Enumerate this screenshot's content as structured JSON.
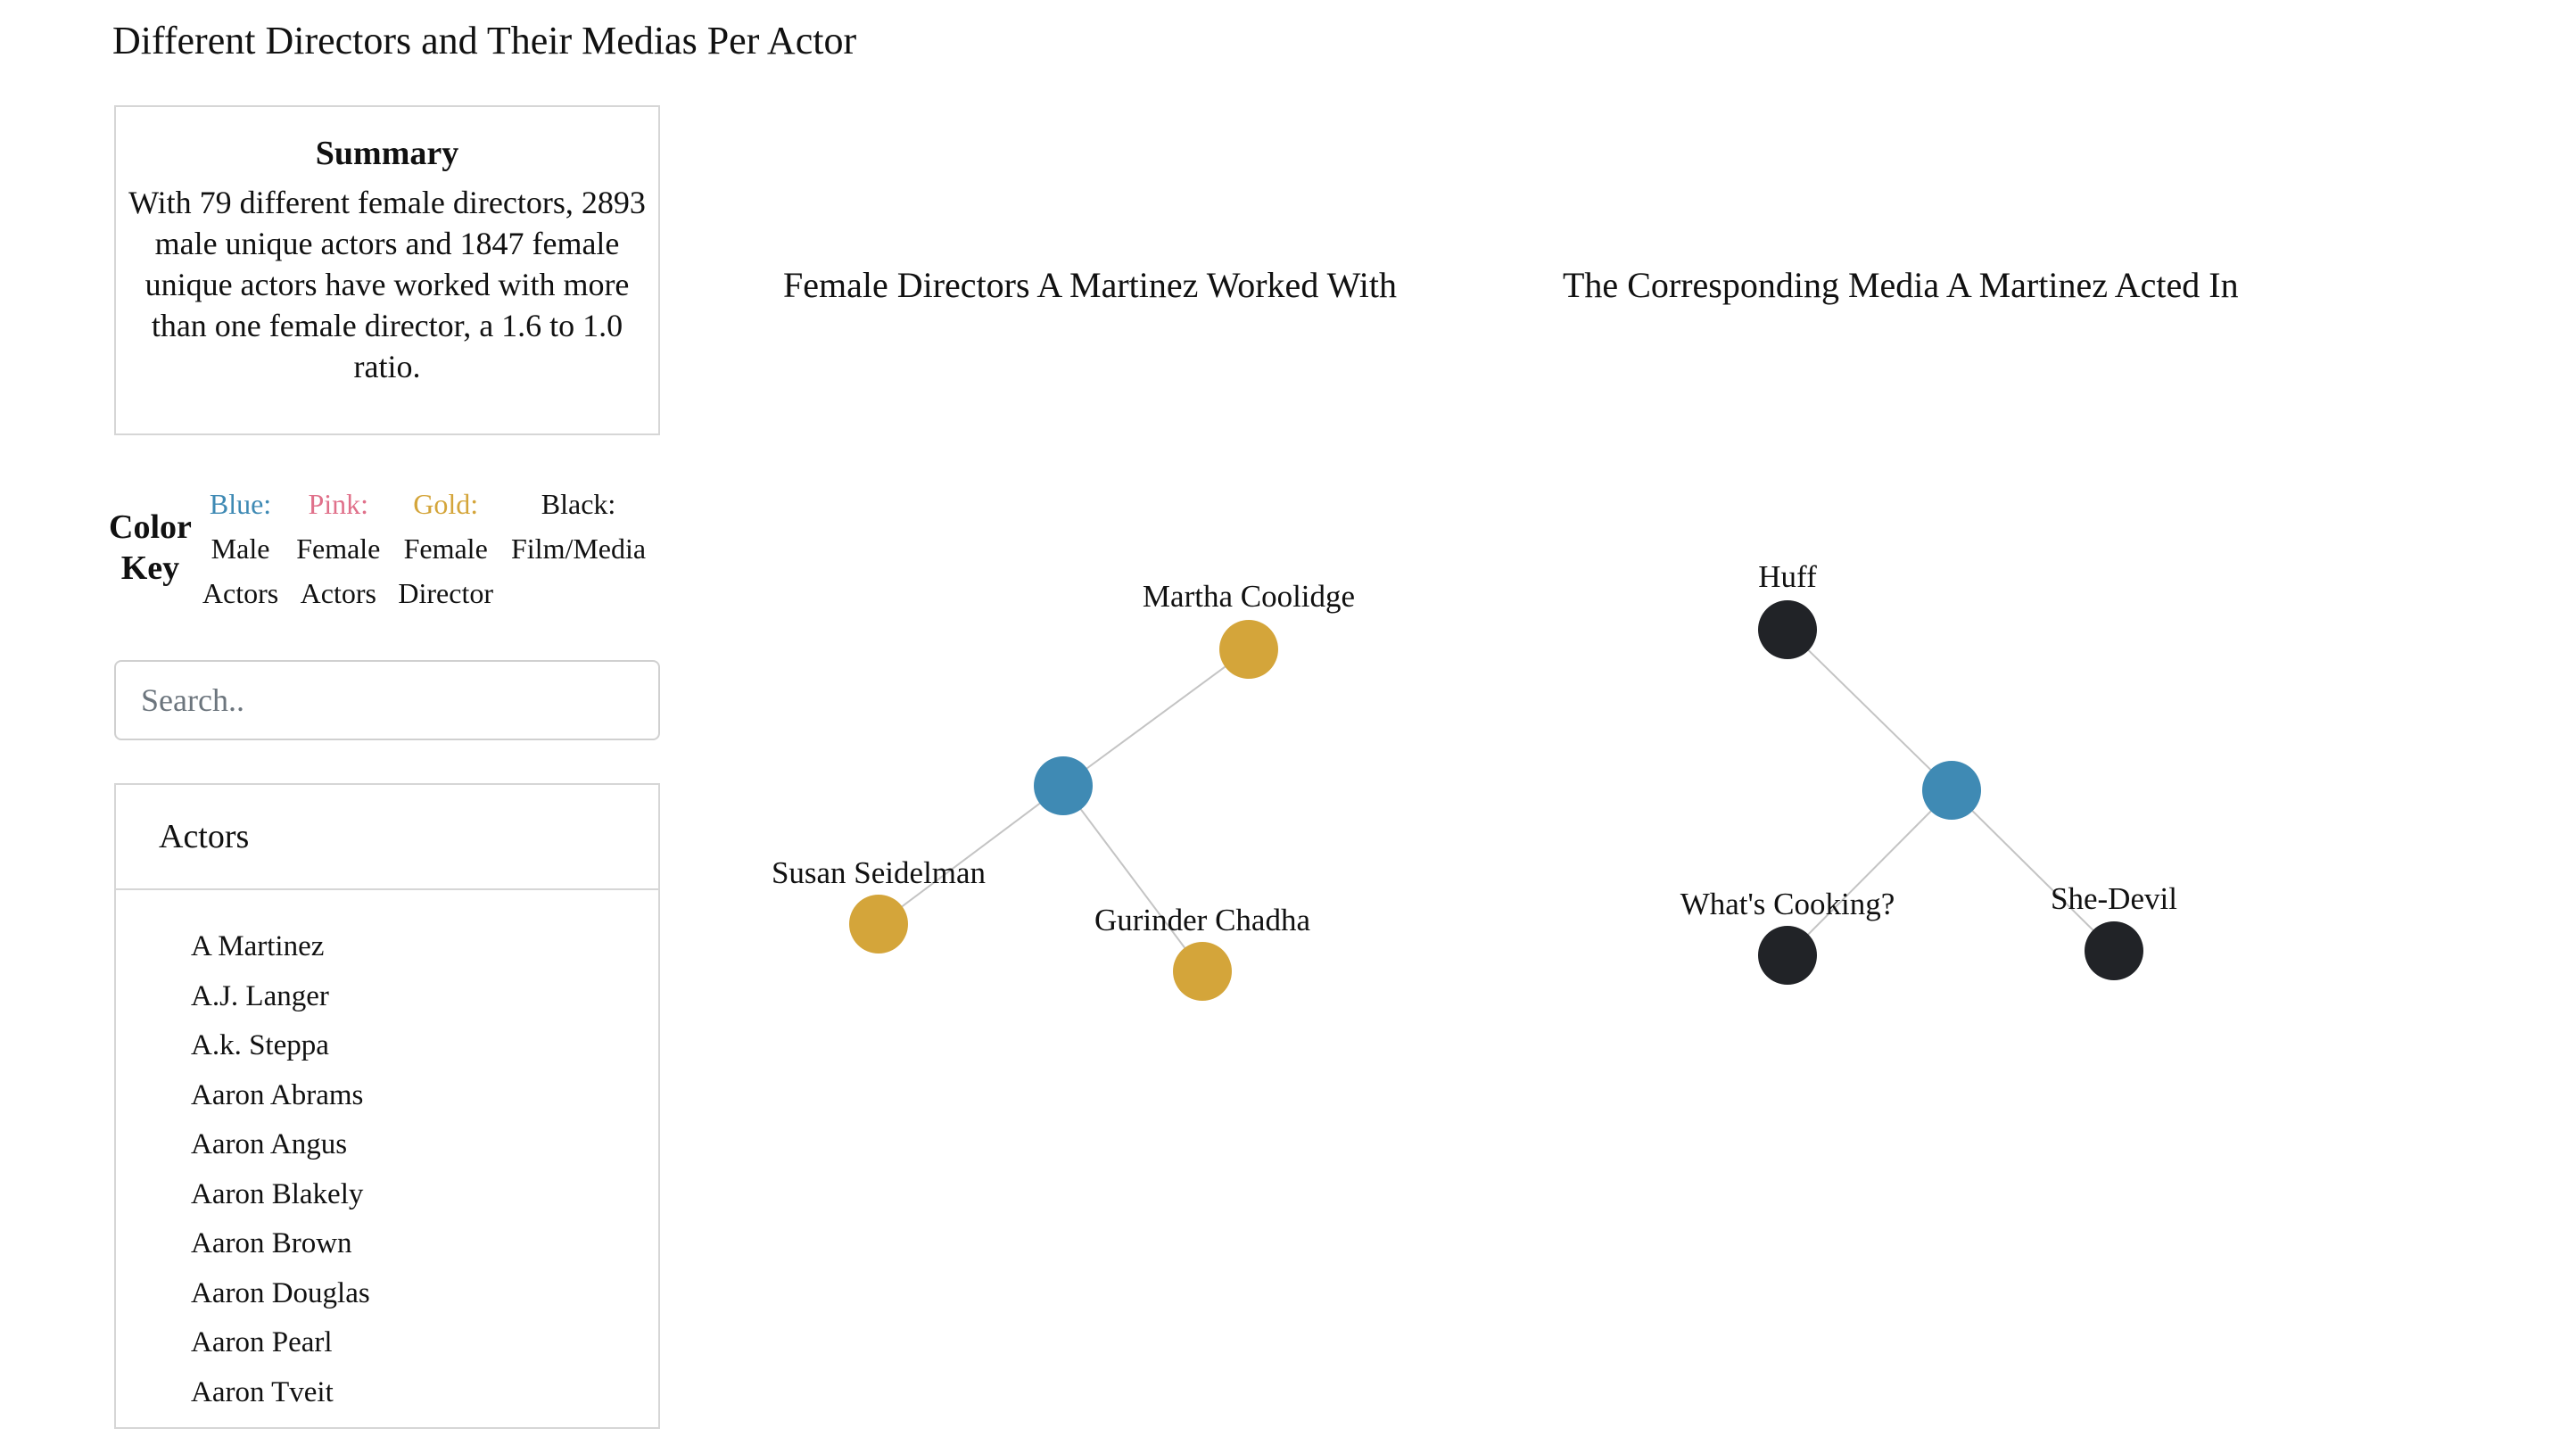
{
  "page": {
    "title": "Different Directors and Their Medias Per Actor"
  },
  "summary": {
    "heading": "Summary",
    "text": "With 79 different female directors, 2893 male unique actors and 1847 female unique actors have worked with more than one female director, a 1.6 to 1.0 ratio."
  },
  "color_key": {
    "label_line1": "Color",
    "label_line2": "Key",
    "entries": [
      {
        "title": "Blue:",
        "line1": "Male",
        "line2": "Actors",
        "color": "#3f8ab4"
      },
      {
        "title": "Pink:",
        "line1": "Female",
        "line2": "Actors",
        "color": "#e0708a"
      },
      {
        "title": "Gold:",
        "line1": "Female",
        "line2": "Director",
        "color": "#d4a53a"
      },
      {
        "title": "Black:",
        "line1": "Film/Media",
        "line2": "",
        "color": "#111111"
      }
    ]
  },
  "search": {
    "placeholder": "Search.."
  },
  "actors": {
    "heading": "Actors",
    "items": [
      "A Martinez",
      "A.J. Langer",
      "A.k. Steppa",
      "Aaron Abrams",
      "Aaron Angus",
      "Aaron Blakely",
      "Aaron Brown",
      "Aaron Douglas",
      "Aaron Pearl",
      "Aaron Tveit"
    ]
  },
  "directors_graph": {
    "title": "Female Directors A Martinez Worked With",
    "center_color": "#3f8ab4",
    "node_color": "#d4a53a",
    "nodes": [
      "Martha Coolidge",
      "Susan Seidelman",
      "Gurinder Chadha"
    ]
  },
  "media_graph": {
    "title": "The Corresponding Media A Martinez Acted In",
    "center_color": "#3f8ab4",
    "node_color": "#212327",
    "nodes": [
      "Huff",
      "What's Cooking?",
      "She-Devil"
    ]
  },
  "colors": {
    "edge": "#c4c4c4",
    "border": "#d6d6d6"
  }
}
